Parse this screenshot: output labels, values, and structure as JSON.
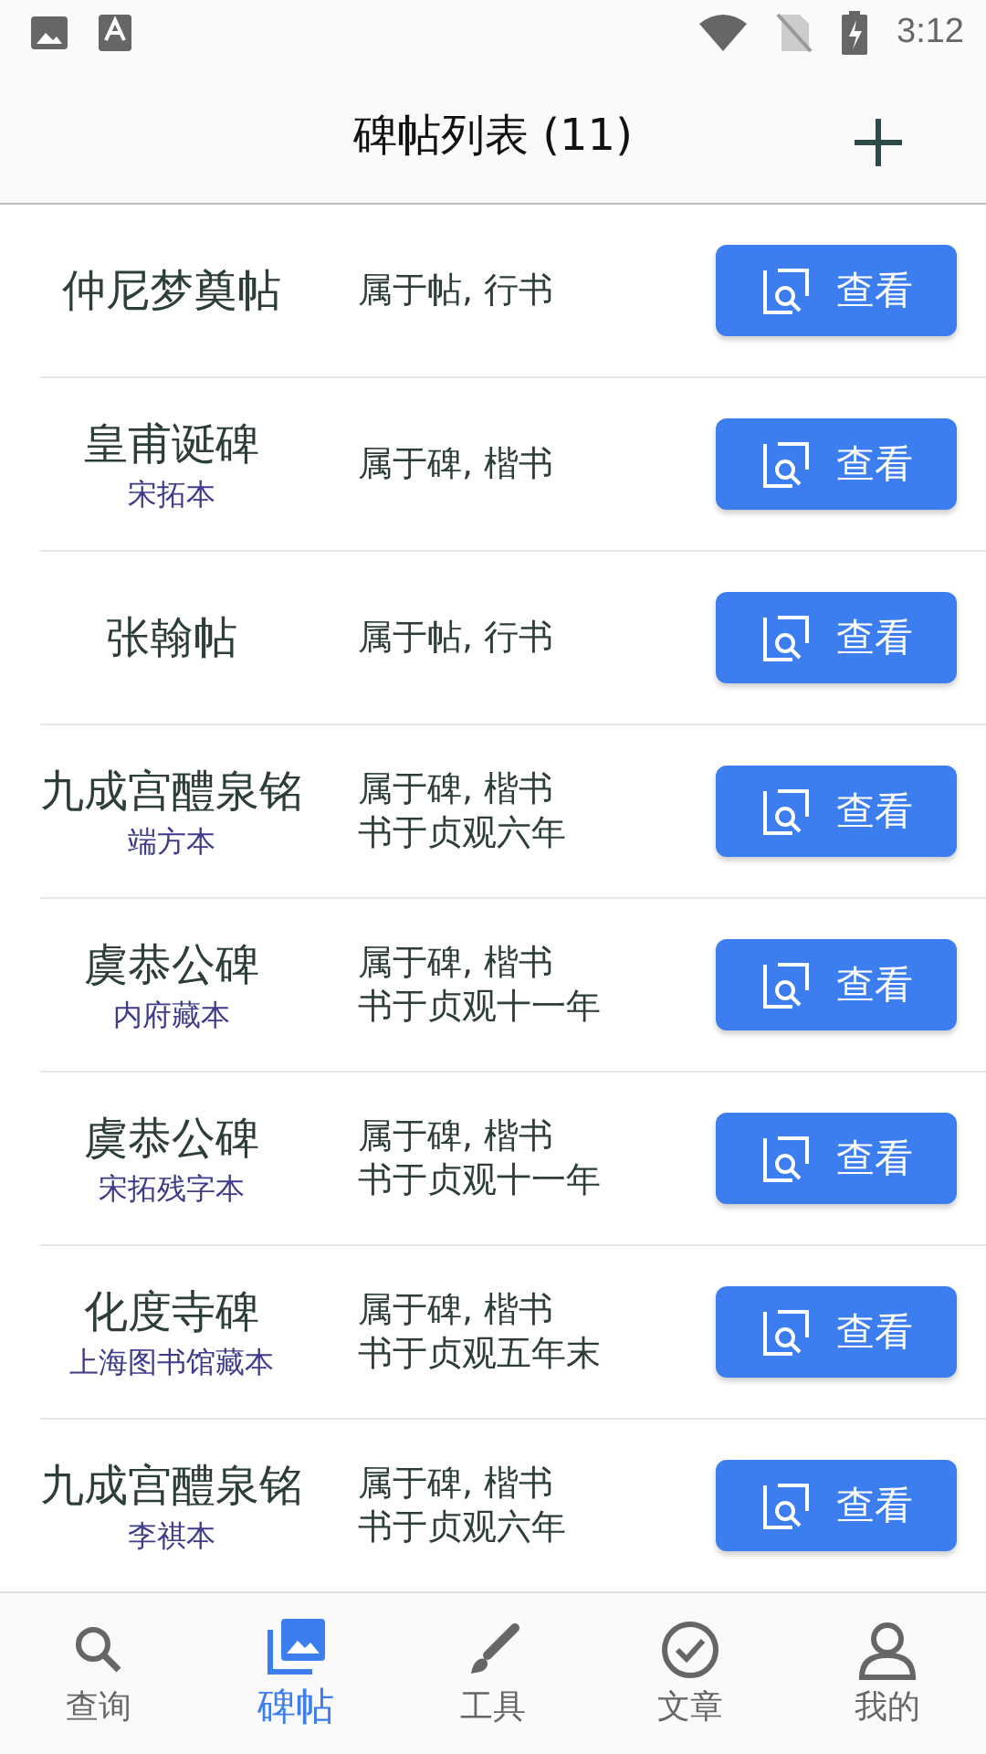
{
  "status_bar": {
    "time": "3:12"
  },
  "app_bar": {
    "title": "碑帖列表 (11)"
  },
  "items": [
    {
      "name": "仲尼梦奠帖",
      "info": [
        "属于帖, 行书"
      ],
      "button": "查看"
    },
    {
      "name": "皇甫诞碑",
      "edition": "宋拓本",
      "info": [
        "属于碑, 楷书"
      ],
      "button": "查看"
    },
    {
      "name": "张翰帖",
      "info": [
        "属于帖, 行书"
      ],
      "button": "查看"
    },
    {
      "name": "九成宫醴泉铭",
      "edition": "端方本",
      "info": [
        "属于碑, 楷书",
        "书于贞观六年"
      ],
      "button": "查看"
    },
    {
      "name": "虞恭公碑",
      "edition": "内府藏本",
      "info": [
        "属于碑, 楷书",
        "书于贞观十一年"
      ],
      "button": "查看"
    },
    {
      "name": "虞恭公碑",
      "edition": "宋拓残字本",
      "info": [
        "属于碑, 楷书",
        "书于贞观十一年"
      ],
      "button": "查看"
    },
    {
      "name": "化度寺碑",
      "edition": "上海图书馆藏本",
      "info": [
        "属于碑, 楷书",
        "书于贞观五年末"
      ],
      "button": "查看"
    },
    {
      "name": "九成宫醴泉铭",
      "edition": "李祺本",
      "info": [
        "属于碑, 楷书",
        "书于贞观六年"
      ],
      "button": "查看"
    }
  ],
  "nav": [
    {
      "kind": "search",
      "label": "查询",
      "selected": false
    },
    {
      "kind": "images",
      "label": "碑帖",
      "selected": true
    },
    {
      "kind": "brush",
      "label": "工具",
      "selected": false
    },
    {
      "kind": "check",
      "label": "文章",
      "selected": false
    },
    {
      "kind": "person",
      "label": "我的",
      "selected": false
    }
  ]
}
